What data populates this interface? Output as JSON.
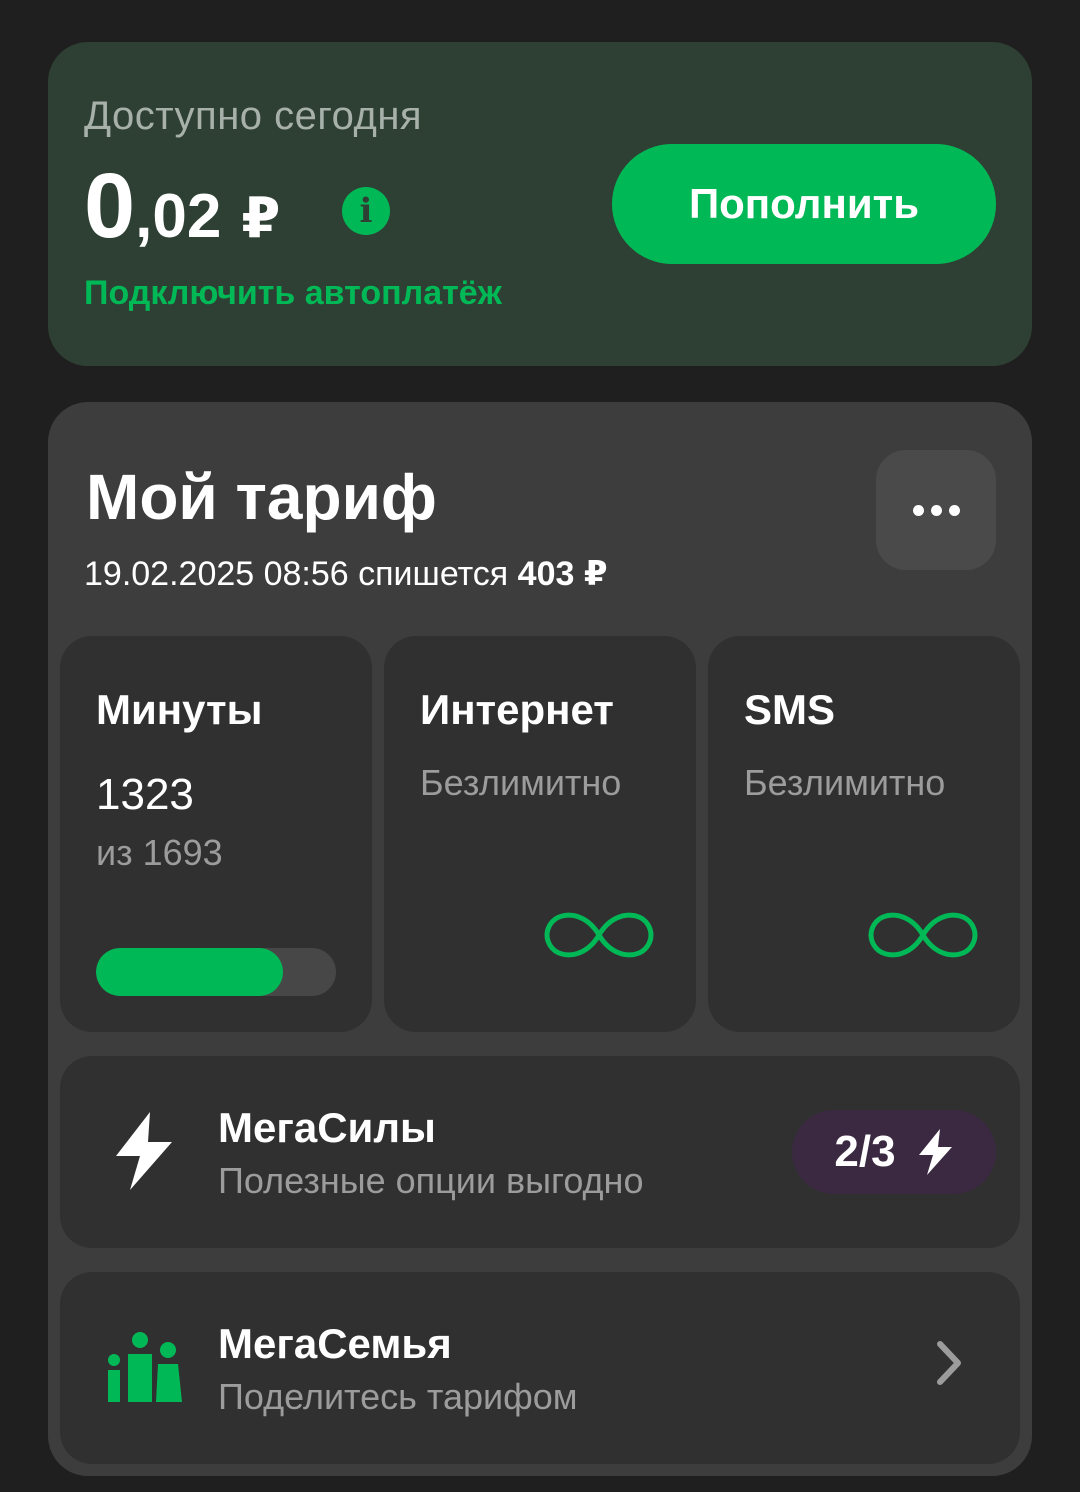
{
  "balance": {
    "label": "Доступно сегодня",
    "amount_int": "0",
    "amount_frac": ",02",
    "currency": "₽",
    "info_icon": "info-icon",
    "autopay_link": "Подключить автоплатёж",
    "topup_button": "Пополнить"
  },
  "tariff": {
    "title": "Мой тариф",
    "charge_date": "19.02.2025 08:56 спишется",
    "charge_amount": "403 ₽",
    "more_icon": "more-dots-icon",
    "tiles": [
      {
        "title": "Минуты",
        "value": "1323",
        "sub": "из 1693",
        "progress": 0.78
      },
      {
        "title": "Интернет",
        "value": "Безлимитно",
        "icon": "infinity-icon"
      },
      {
        "title": "SMS",
        "value": "Безлимитно",
        "icon": "infinity-icon"
      }
    ],
    "megasily": {
      "title": "МегаСилы",
      "subtitle": "Полезные опции выгодно",
      "icon": "bolt-icon",
      "badge": "2/3"
    },
    "megasemya": {
      "title": "МегаСемья",
      "subtitle": "Поделитесь тарифом",
      "icon": "family-icon"
    }
  },
  "colors": {
    "accent": "#00b956",
    "balance_bg": "#2e4034",
    "card_bg": "#3d3d3d",
    "tile_bg": "#303030",
    "badge_bg": "#3a2940"
  }
}
